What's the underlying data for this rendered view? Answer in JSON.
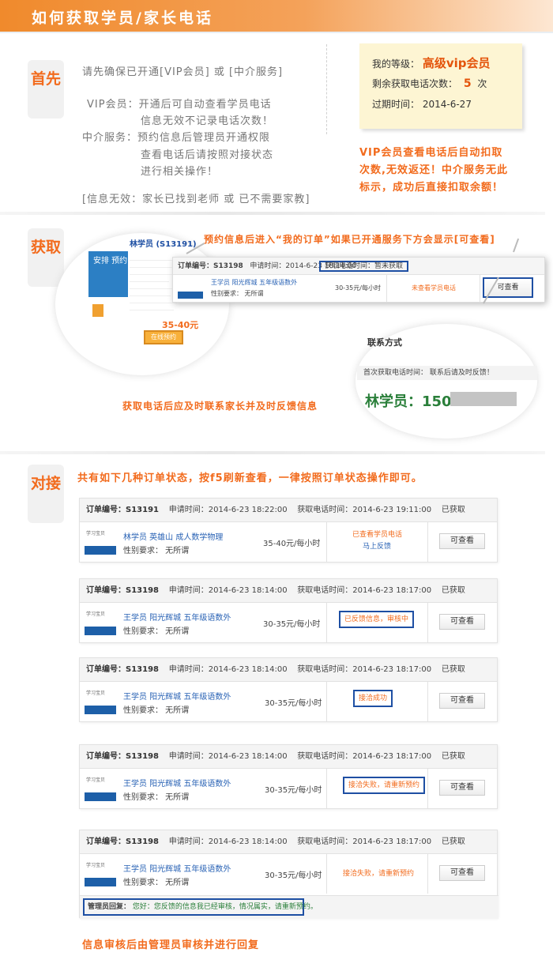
{
  "header": {
    "title": "如何获取学员/家长电话"
  },
  "section1": {
    "tag": "首先",
    "line1": "请先确保已开通[VIP会员] 或 [中介服务]",
    "vip_line1": "VIP会员：开通后可自动查看学员电话",
    "vip_line2": "信息无效不记录电话次数！",
    "agent_line1": "中介服务：预约信息后管理员开通权限",
    "agent_line2": "查看电话后请按照对接状态",
    "agent_line3": "进行相关操作！",
    "invalid_note": "[信息无效：家长已找到老师 或 已不需要家教]",
    "level_label": "我的等级：",
    "level_value": "高级vip会员",
    "remain_label": "剩余获取电话次数：",
    "remain_value": "5",
    "remain_unit": "次",
    "expire_label": "过期时间：",
    "expire_value": "2014-6-27",
    "note_line1": "VIP会员查看电话后自动扣取",
    "note_line2": "次数,无效返还！中介服务无此",
    "note_line3": "标示，成功后直接扣取余额！"
  },
  "section2": {
    "tag": "获取",
    "tip": "预约信息后进入“我的订单”如果已开通服务下方会显示[可查看]",
    "card_title": "林学员 (S13191)",
    "side_label": "安排\n预约",
    "mini_price": "35-40元",
    "mini_button": "在线预约",
    "pop_order_no": "订单编号：S13198",
    "pop_apply_time": "申请时间：2014-6-23 18:14:00",
    "pop_get_time": "获取电话时间：暂未获取",
    "pop_student": "王学员   阳光辉城  五年级语数外",
    "pop_req": "性别要求：  无所谓",
    "pop_price": "30-35元/每小时",
    "pop_status": "未查看学员电话",
    "pop_view": "可查看",
    "contact_title": "联系方式",
    "contact_bar": "首次获取电话时间：    联系后请及时反馈！",
    "contact_name": "林学员：150",
    "bottom_tip": "获取电话后应及时联系家长并及时反馈信息"
  },
  "section3": {
    "tag": "对接",
    "tip": "共有如下几种订单状态，按f5刷新查看，一律按照订单状态操作即可。",
    "thumb_text": "学习宝贝",
    "req_text": "性别要求：   无所谓",
    "view_label": "可查看",
    "orders": [
      {
        "order_no": "订单编号：S13191",
        "apply_time": "申请时间：2014-6-23 18:22:00",
        "get_time": "获取电话时间：2014-6-23 19:11:00",
        "state": "已获取",
        "student": "林学员   英雄山  成人数学物理",
        "price": "35-40元/每小时",
        "status_line1": "已查看学员电话",
        "status_line2": "马上反馈"
      },
      {
        "order_no": "订单编号：S13198",
        "apply_time": "申请时间：2014-6-23 18:14:00",
        "get_time": "获取电话时间：2014-6-23 18:17:00",
        "state": "已获取",
        "student": "王学员   阳光辉城  五年级语数外",
        "price": "30-35元/每小时",
        "status_line1": "已反馈信息，审核中",
        "status_line2": ""
      },
      {
        "order_no": "订单编号：S13198",
        "apply_time": "申请时间：2014-6-23 18:14:00",
        "get_time": "获取电话时间：2014-6-23 18:17:00",
        "state": "已获取",
        "student": "王学员   阳光辉城  五年级语数外",
        "price": "30-35元/每小时",
        "status_line1": "接洽成功",
        "status_line2": ""
      },
      {
        "order_no": "订单编号：S13198",
        "apply_time": "申请时间：2014-6-23 18:14:00",
        "get_time": "获取电话时间：2014-6-23 18:17:00",
        "state": "已获取",
        "student": "王学员   阳光辉城  五年级语数外",
        "price": "30-35元/每小时",
        "status_line1": "接洽失败，请重新预约",
        "status_line2": ""
      },
      {
        "order_no": "订单编号：S13198",
        "apply_time": "申请时间：2014-6-23 18:14:00",
        "get_time": "获取电话时间：2014-6-23 18:17:00",
        "state": "已获取",
        "student": "王学员   阳光辉城  五年级语数外",
        "price": "30-35元/每小时",
        "status_line1": "接洽失败，请重新预约",
        "status_line2": ""
      }
    ],
    "reply_label": "管理员回复：",
    "reply_text": "您好：您反馈的信息我已经审核，情况属实，请重新预约。",
    "bottom_tip": "信息审核后由管理员审核并进行回复"
  }
}
